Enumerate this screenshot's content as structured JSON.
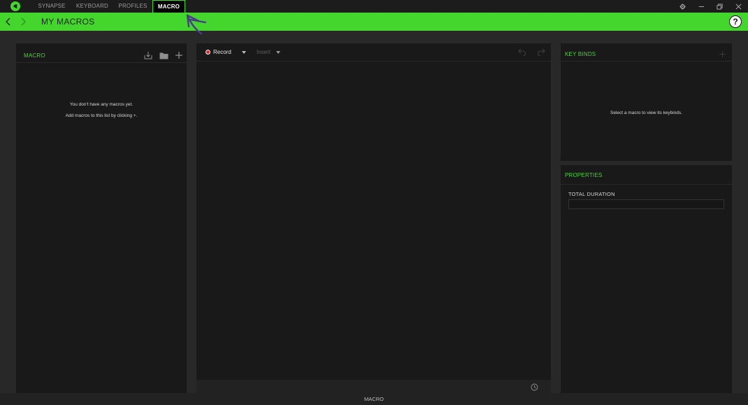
{
  "nav": {
    "tabs": [
      {
        "label": "SYNAPSE",
        "active": false
      },
      {
        "label": "KEYBOARD",
        "active": false
      },
      {
        "label": "PROFILES",
        "active": false
      },
      {
        "label": "MACRO",
        "active": true
      }
    ],
    "window_controls": [
      "gear-icon",
      "minimize-icon",
      "restore-icon",
      "close-icon"
    ]
  },
  "header": {
    "title": "MY MACROS",
    "help_label": "?"
  },
  "macro_panel": {
    "title": "MACRO",
    "empty_line1": "You don't have any macros yet.",
    "empty_line2": "Add macros to this list by clicking +.",
    "icons": [
      "import-icon",
      "folder-icon",
      "plus-icon"
    ]
  },
  "editor": {
    "record_label": "Record",
    "insert_label": "Insert"
  },
  "keybinds_panel": {
    "title": "KEY BINDS",
    "message": "Select a macro to view its keybinds."
  },
  "properties_panel": {
    "title": "PROPERTIES",
    "total_duration_label": "TOTAL DURATION",
    "total_duration_value": ""
  },
  "status_bar": {
    "label": "MACRO"
  },
  "colors": {
    "accent": "#44d62c",
    "background": "#282828",
    "panel": "#191919",
    "annotation": "#4a3a8a"
  }
}
